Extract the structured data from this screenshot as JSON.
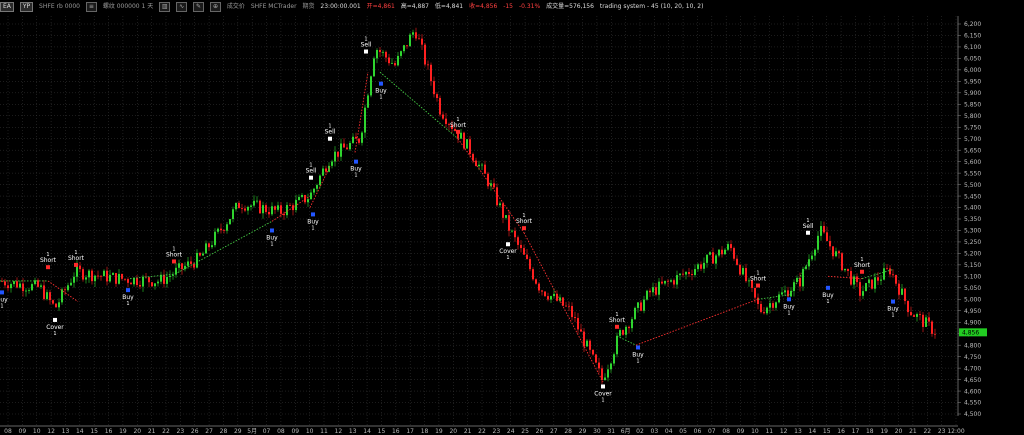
{
  "topbar": {
    "btn1": "EA",
    "btn2": "YP",
    "symbol": "SHFE rb 0000",
    "code": "螺纹 000000 1 天",
    "exchange_label": "成交价",
    "source": "SHFE MCTrader",
    "period": "期货",
    "time": "23:00:00.001",
    "open_val": "开=4,861",
    "high_val": "高=4,887",
    "low_val": "低=4,841",
    "close_val": "收=4,856",
    "change_val": "-15",
    "change_pct": "-0.31%",
    "volume_val": "成交量=576,156",
    "system_label": "trading system - 45 (10, 20, 10, 2)"
  },
  "price_axis": {
    "labels": [
      "6,200",
      "6,150",
      "6,100",
      "6,050",
      "6,000",
      "5,950",
      "5,900",
      "5,850",
      "5,800",
      "5,750",
      "5,700",
      "5,650",
      "5,600",
      "5,550",
      "5,500",
      "5,450",
      "5,400",
      "5,350",
      "5,300",
      "5,250",
      "5,200",
      "5,150",
      "5,100",
      "5,050",
      "5,000",
      "4,950",
      "4,900",
      "4,850",
      "4,800",
      "4,750",
      "4,700",
      "4,650",
      "4,600",
      "4,550",
      "4,500"
    ],
    "current_label": "4,856"
  },
  "date_axis": {
    "labels": [
      "08",
      "09",
      "10",
      "12",
      "13",
      "14",
      "15",
      "16",
      "19",
      "20",
      "21",
      "22",
      "23",
      "26",
      "27",
      "28",
      "29",
      "5月",
      "07",
      "08",
      "09",
      "10",
      "11",
      "12",
      "13",
      "14",
      "15",
      "16",
      "17",
      "18",
      "19",
      "20",
      "21",
      "22",
      "23",
      "24",
      "25",
      "26",
      "27",
      "28",
      "29",
      "30",
      "31",
      "6月",
      "02",
      "03",
      "04",
      "05",
      "06",
      "07",
      "08",
      "09",
      "10",
      "11",
      "12",
      "13",
      "14",
      "15",
      "16",
      "17",
      "18",
      "19",
      "20",
      "21",
      "22",
      "23",
      "12:00"
    ]
  },
  "signals": [
    {
      "label": "Buy",
      "qty": "1",
      "kind": "buy"
    },
    {
      "label": "Short",
      "qty": "1",
      "kind": "short"
    },
    {
      "label": "Cover",
      "qty": "1",
      "kind": "cover"
    },
    {
      "label": "Short",
      "qty": "1",
      "kind": "short"
    },
    {
      "label": "Buy",
      "qty": "1",
      "kind": "buy"
    },
    {
      "label": "Short",
      "qty": "1",
      "kind": "short"
    },
    {
      "label": "Buy",
      "qty": "1",
      "kind": "buy"
    },
    {
      "label": "Buy",
      "qty": "1",
      "kind": "buy"
    },
    {
      "label": "Sell",
      "qty": "1",
      "kind": "sell"
    },
    {
      "label": "Sell",
      "qty": "1",
      "kind": "sell"
    },
    {
      "label": "Buy",
      "qty": "1",
      "kind": "buy"
    },
    {
      "label": "Sell",
      "qty": "1",
      "kind": "sell"
    },
    {
      "label": "Buy",
      "qty": "1",
      "kind": "buy"
    },
    {
      "label": "Short",
      "qty": "1",
      "kind": "short"
    },
    {
      "label": "Cover",
      "qty": "1",
      "kind": "cover"
    },
    {
      "label": "Short",
      "qty": "1",
      "kind": "short"
    },
    {
      "label": "Cover",
      "qty": "1",
      "kind": "cover"
    },
    {
      "label": "Short",
      "qty": "1",
      "kind": "short"
    },
    {
      "label": "Buy",
      "qty": "1",
      "kind": "buy"
    },
    {
      "label": "Short",
      "qty": "1",
      "kind": "short"
    },
    {
      "label": "Buy",
      "qty": "1",
      "kind": "buy"
    },
    {
      "label": "Sell",
      "qty": "1",
      "kind": "sell"
    },
    {
      "label": "Buy",
      "qty": "1",
      "kind": "buy"
    },
    {
      "label": "Short",
      "qty": "1",
      "kind": "short"
    },
    {
      "label": "Buy",
      "qty": "1",
      "kind": "buy"
    }
  ],
  "colors": {
    "background": "#000000",
    "up": "#2fd52f",
    "down": "#ff2020",
    "grid": "#3a3a3a",
    "axis_text": "#bbbbbb",
    "current_price_bg": "#22cc22"
  }
}
